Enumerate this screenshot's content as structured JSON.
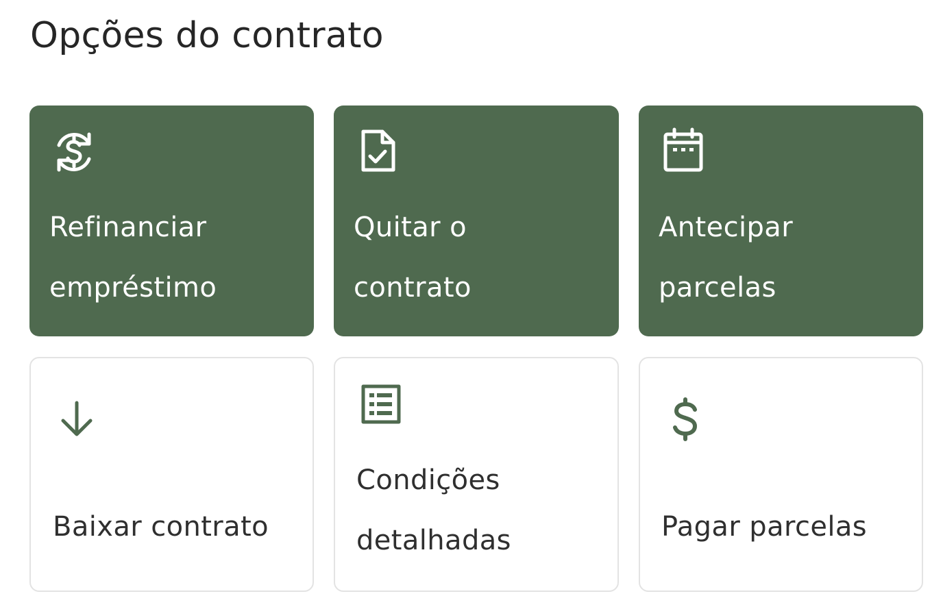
{
  "section": {
    "title": "Opções do contrato"
  },
  "colors": {
    "primary_card": "#4f6a4f",
    "secondary_border": "#e3e3e3",
    "accent_icon": "#4f6a4f"
  },
  "cards": [
    {
      "label": "Refinanciar empréstimo",
      "icon": "refinance-dollar-icon",
      "style": "primary"
    },
    {
      "label": "Quitar o contrato",
      "icon": "document-check-icon",
      "style": "primary"
    },
    {
      "label": "Antecipar parcelas",
      "icon": "calendar-icon",
      "style": "primary"
    },
    {
      "label": "Baixar contrato",
      "icon": "arrow-down-icon",
      "style": "secondary"
    },
    {
      "label": "Condições detalhadas",
      "icon": "list-details-icon",
      "style": "secondary"
    },
    {
      "label": "Pagar parcelas",
      "icon": "dollar-icon",
      "style": "secondary"
    }
  ]
}
